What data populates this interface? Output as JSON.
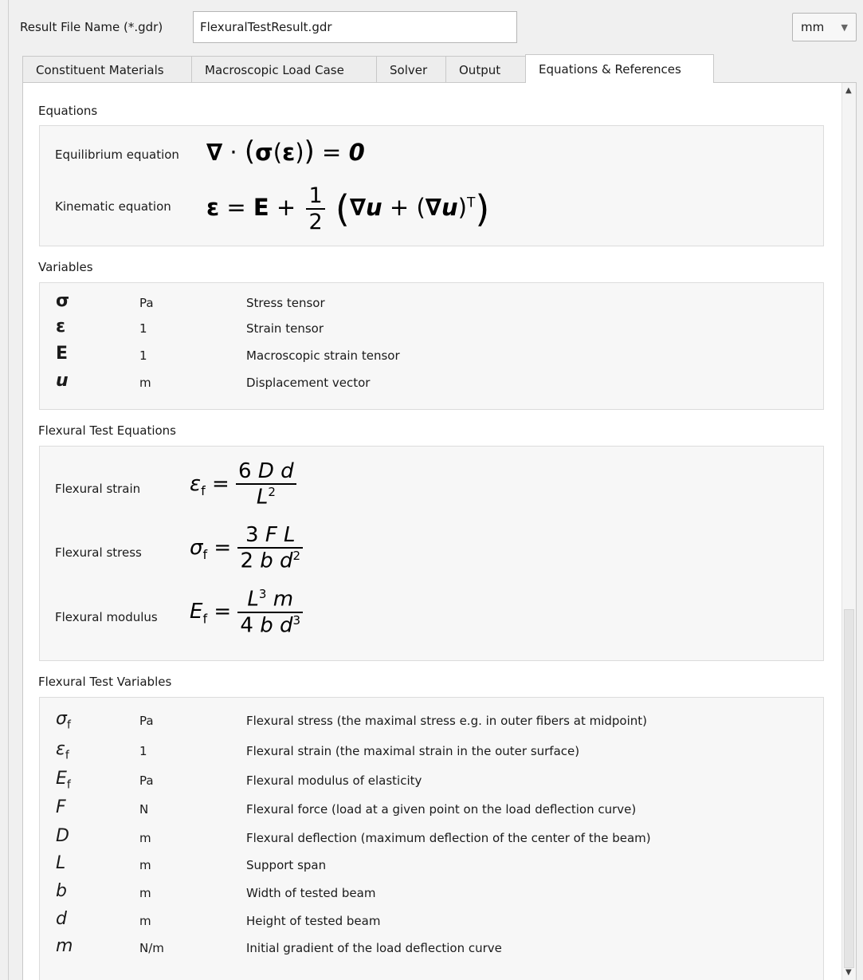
{
  "header": {
    "file_label": "Result File Name (*.gdr)",
    "file_value": "FlexuralTestResult.gdr",
    "unit_value": "mm"
  },
  "tabs": [
    {
      "label": "Constituent Materials"
    },
    {
      "label": "Macroscopic Load Case"
    },
    {
      "label": "Solver"
    },
    {
      "label": "Output"
    },
    {
      "label": "Equations & References"
    }
  ],
  "equations": {
    "title": "Equations",
    "equilibrium_label": "Equilibrium equation",
    "kinematic_label": "Kinematic equation"
  },
  "variables": {
    "title": "Variables",
    "rows": [
      {
        "symbol": "σ",
        "unit": "Pa",
        "desc": "Stress tensor"
      },
      {
        "symbol": "ε",
        "unit": "1",
        "desc": "Strain tensor"
      },
      {
        "symbol": "E",
        "unit": "1",
        "desc": "Macroscopic strain tensor"
      },
      {
        "symbol": "u",
        "unit": "m",
        "desc": "Displacement vector"
      }
    ]
  },
  "flexural_equations": {
    "title": "Flexural Test Equations",
    "strain_label": "Flexural strain",
    "stress_label": "Flexural stress",
    "modulus_label": "Flexural modulus"
  },
  "flexural_variables": {
    "title": "Flexural Test Variables",
    "rows": [
      {
        "symbol": "σ",
        "sub": "f",
        "unit": "Pa",
        "desc": "Flexural stress (the maximal stress e.g. in outer fibers at midpoint)"
      },
      {
        "symbol": "ε",
        "sub": "f",
        "unit": "1",
        "desc": "Flexural strain (the maximal strain in the outer surface)"
      },
      {
        "symbol": "E",
        "sub": "f",
        "unit": "Pa",
        "desc": "Flexural modulus of elasticity"
      },
      {
        "symbol": "F",
        "sub": "",
        "unit": "N",
        "desc": "Flexural force (load at a given point on the load deflection curve)"
      },
      {
        "symbol": "D",
        "sub": "",
        "unit": "m",
        "desc": "Flexural deflection (maximum deflection of the center of the beam)"
      },
      {
        "symbol": "L",
        "sub": "",
        "unit": "m",
        "desc": "Support span"
      },
      {
        "symbol": "b",
        "sub": "",
        "unit": "m",
        "desc": "Width of tested beam"
      },
      {
        "symbol": "d",
        "sub": "",
        "unit": "m",
        "desc": "Height of tested beam"
      },
      {
        "symbol": "m",
        "sub": "",
        "unit": "N/m",
        "desc": "Initial gradient of the load deflection curve"
      }
    ]
  }
}
